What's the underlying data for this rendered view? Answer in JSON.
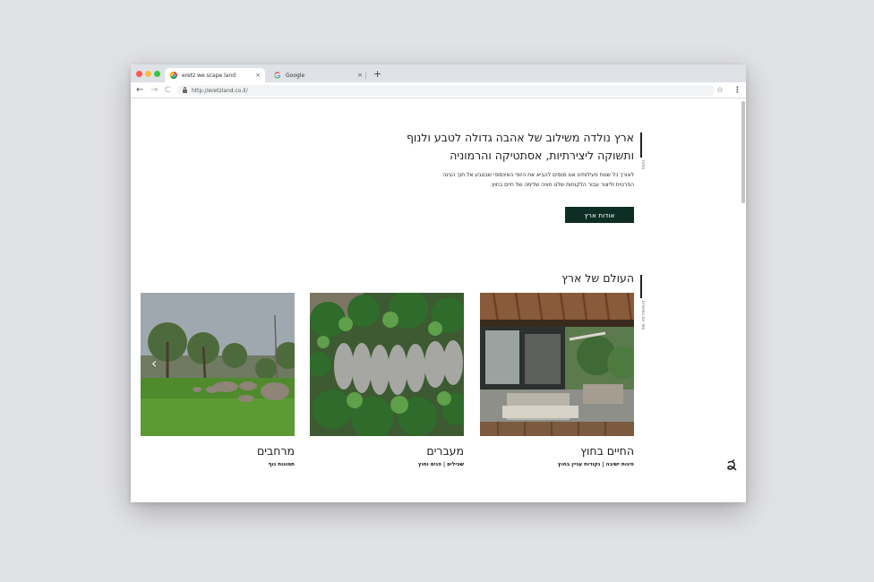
{
  "browser": {
    "tabs": [
      {
        "title": "eretz we scape land",
        "icon": "chrome-icon",
        "close": "×"
      },
      {
        "title": "Google",
        "icon": "google-g-icon",
        "close": "×"
      }
    ],
    "new_tab": "+",
    "url": "http://eretzland.co.il/",
    "nav": {
      "back": "←",
      "forward": "→",
      "reload": "C"
    },
    "star": "☆",
    "menu": "⋮"
  },
  "about": {
    "heading_line1": "ארץ נולדה משילוב של אהבה גדולה לטבע ולנוף",
    "heading_line2": "ותשוקה ליצירתיות, אסתטיקה והרמוניה",
    "side_label": "אודות",
    "paragraph_line1": "לאורך כל שנות פעילותינו אנו מנסים להביא את היופי האינסופי שבטבע אל תוך הגינה",
    "paragraph_line2": "הפרטית וליצור עבור הלקוחות שלנו חוויה שלימה של חיים בחוץ.",
    "button": "אודות ארץ"
  },
  "world": {
    "title": "העולם של ארץ",
    "side_label": "ספר את הסיפורים",
    "cards": [
      {
        "title": "החיים בחוץ",
        "subtitle": "פינות ישיבה | נקודות עניין בחוץ"
      },
      {
        "title": "מעברים",
        "subtitle": "שבילים | פנים וחוץ"
      },
      {
        "title": "מרחבים",
        "subtitle": "תמונות נוף"
      }
    ],
    "prev_arrow": "‹"
  },
  "colors": {
    "accent": "#0d2e24",
    "text": "#222222",
    "background": "#e1e2e4"
  }
}
